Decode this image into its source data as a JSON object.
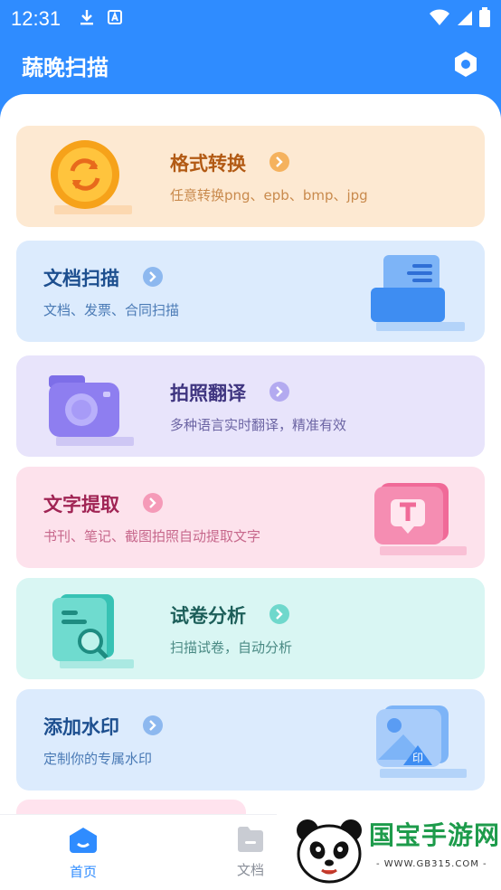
{
  "status_bar": {
    "time": "12:31"
  },
  "app_bar": {
    "title": "蔬晚扫描"
  },
  "cards": [
    {
      "title": "格式转换",
      "desc": "任意转换png、epb、bmp、jpg",
      "bg": "#fde9d2",
      "title_color": "#b25a14",
      "desc_color": "#c98a4d",
      "chev_color": "#f5b25e"
    },
    {
      "title": "文档扫描",
      "desc": "文档、发票、合同扫描",
      "bg": "#dcebfd",
      "title_color": "#1d4f8f",
      "desc_color": "#4a7ab5",
      "chev_color": "#8db8ef"
    },
    {
      "title": "拍照翻译",
      "desc": "多种语言实时翻译，精准有效",
      "bg": "#e8e4fb",
      "title_color": "#3f3580",
      "desc_color": "#6b64a3",
      "chev_color": "#b3aaf0"
    },
    {
      "title": "文字提取",
      "desc": "书刊、笔记、截图拍照自动提取文字",
      "bg": "#fde2ec",
      "title_color": "#a02454",
      "desc_color": "#c7688c",
      "chev_color": "#f59ab8"
    },
    {
      "title": "试卷分析",
      "desc": "扫描试卷，自动分析",
      "bg": "#d9f6f3",
      "title_color": "#1d5f5a",
      "desc_color": "#4a8a84",
      "chev_color": "#6fd8cc"
    },
    {
      "title": "添加水印",
      "desc": "定制你的专属水印",
      "bg": "#dcebfd",
      "title_color": "#1d4f8f",
      "desc_color": "#4a7ab5",
      "chev_color": "#8db8ef"
    }
  ],
  "nav": {
    "items": [
      {
        "label": "首页",
        "active": true
      },
      {
        "label": "文档",
        "active": false
      }
    ]
  },
  "watermark": {
    "text": "国宝手游网",
    "url": "- WWW.GB315.COM -"
  },
  "colors": {
    "primary": "#2f8cff"
  }
}
